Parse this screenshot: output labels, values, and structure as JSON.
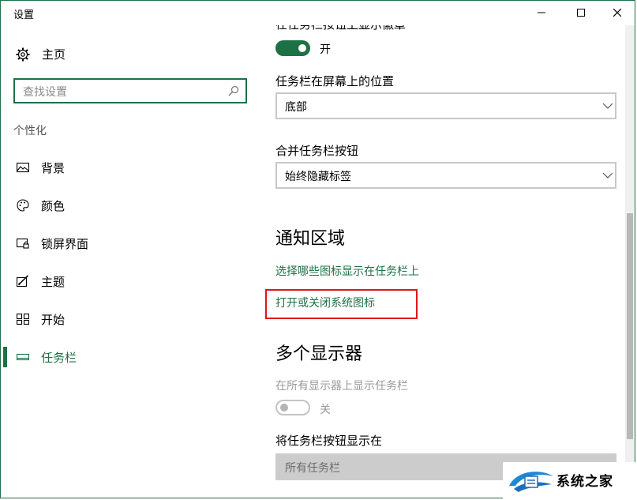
{
  "window": {
    "title": "设置"
  },
  "sidebar": {
    "home_label": "主页",
    "search_placeholder": "查找设置",
    "section_title": "个性化",
    "items": [
      {
        "label": "背景",
        "icon": "picture-icon"
      },
      {
        "label": "颜色",
        "icon": "palette-icon"
      },
      {
        "label": "锁屏界面",
        "icon": "lock-screen-icon"
      },
      {
        "label": "主题",
        "icon": "theme-icon"
      },
      {
        "label": "开始",
        "icon": "start-tiles-icon"
      },
      {
        "label": "任务栏",
        "icon": "taskbar-icon",
        "active": true
      }
    ]
  },
  "main": {
    "badges_setting_label": "在任务栏按钮上显示徽章",
    "badges_toggle_state": "开",
    "position_label": "任务栏在屏幕上的位置",
    "position_value": "底部",
    "combine_label": "合并任务栏按钮",
    "combine_value": "始终隐藏标签",
    "notification_heading": "通知区域",
    "notification_link_1": "选择哪些图标显示在任务栏上",
    "notification_link_2": "打开或关闭系统图标",
    "multi_display_heading": "多个显示器",
    "show_all_displays_label": "在所有显示器上显示任务栏",
    "show_all_displays_state": "关",
    "buttons_on_label": "将任务栏按钮显示在",
    "buttons_on_value": "所有任务栏"
  },
  "colors": {
    "accent": "#1e7145",
    "highlight_box": "#e2131a"
  },
  "watermark": {
    "text": "系统之家"
  }
}
